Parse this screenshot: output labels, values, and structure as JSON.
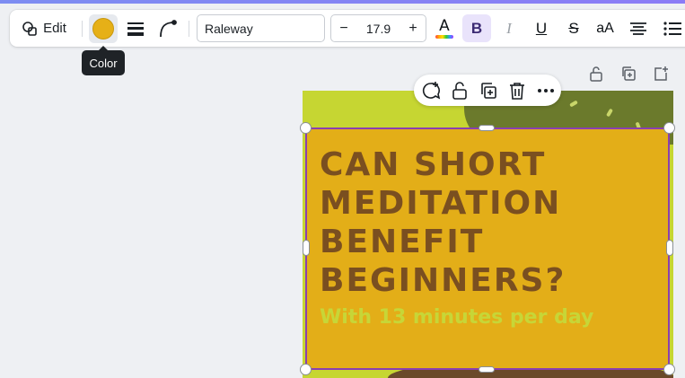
{
  "toolbar": {
    "edit_label": "Edit",
    "font_name": "Raleway",
    "font_size": "17.9",
    "minus": "−",
    "plus": "+",
    "text_color_glyph": "A",
    "bold_glyph": "B",
    "italic_glyph": "I",
    "underline_glyph": "U",
    "strike_glyph": "S",
    "case_glyph": "aA",
    "fill_color": "#E6B017"
  },
  "tooltip": {
    "label": "Color"
  },
  "canvas": {
    "headline": "CAN SHORT MEDITATION BENEFIT BEGINNERS?",
    "subline": "With 13 minutes per day",
    "box_color": "#E3AE18",
    "headline_color": "#7A4F20",
    "subline_color": "#C7D637",
    "background_color": "#C6D632"
  },
  "floating_toolbar": {
    "icons": [
      "comment-add-icon",
      "lock-icon",
      "duplicate-icon",
      "trash-icon",
      "more-icon"
    ]
  },
  "page_actions": {
    "icons": [
      "lock-icon",
      "duplicate-page-icon",
      "add-page-icon"
    ]
  }
}
